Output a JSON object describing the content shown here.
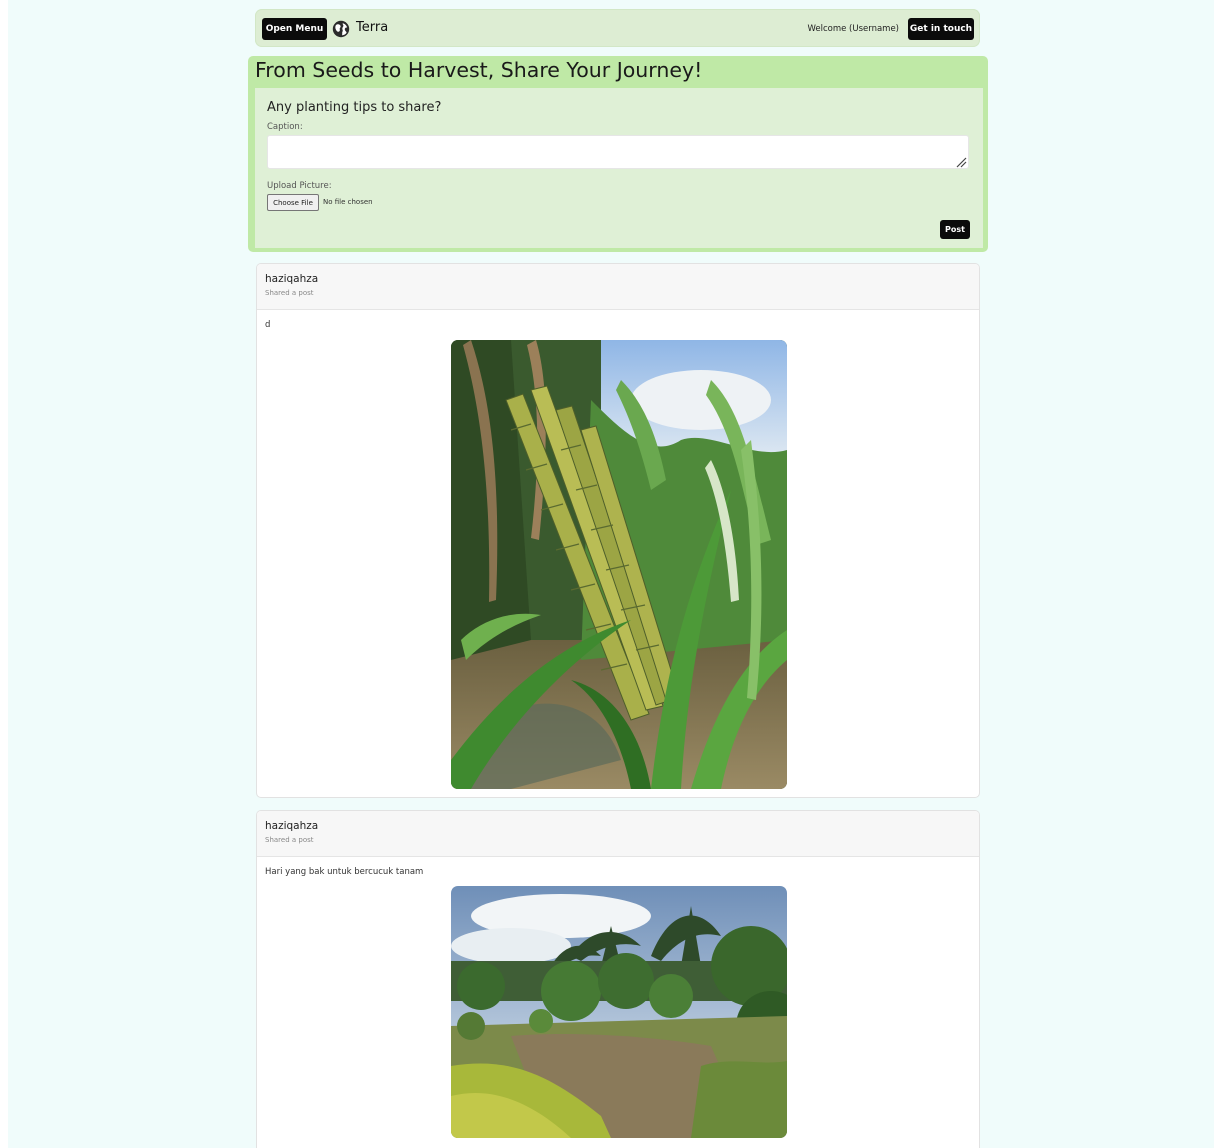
{
  "header": {
    "menu_label": "Open Menu",
    "brand_name": "Terra",
    "brand_icon": "globe-icon",
    "welcome_text": "Welcome (Username)",
    "contact_label": "Get in touch"
  },
  "hero": {
    "title": "From Seeds to Harvest, Share Your Journey!"
  },
  "composer": {
    "prompt": "Any planting tips to share?",
    "caption_label": "Caption:",
    "caption_value": "",
    "upload_label": "Upload Picture:",
    "choose_file_label": "Choose File",
    "no_file_text": "No file chosen",
    "post_label": "Post"
  },
  "posts": [
    {
      "username": "haziqahza",
      "subtitle": "Shared a post",
      "caption": "d",
      "image": "sugarcane-stalks-photo"
    },
    {
      "username": "haziqahza",
      "subtitle": "Shared a post",
      "caption": "Hari yang bak untuk bercucuk tanam",
      "image": "farm-field-palms-photo"
    }
  ],
  "colors": {
    "page_background": "#f0fcfb",
    "header_background": "#ddedd3",
    "composer_border": "#bfe9a6",
    "composer_background": "#dff0d6",
    "button_dark": "#0b0b0b"
  }
}
